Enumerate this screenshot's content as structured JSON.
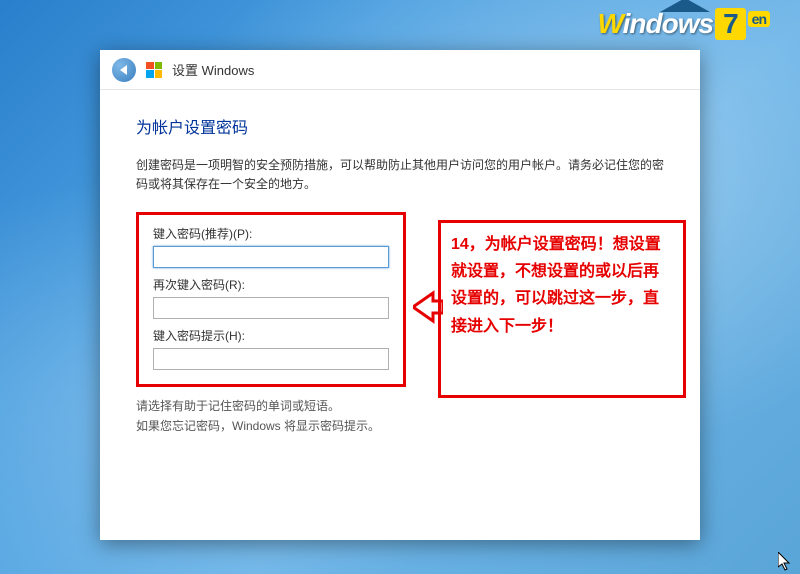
{
  "logo": {
    "brand_w": "W",
    "brand_indows": "indows",
    "brand_7": "7",
    "brand_suffix": "en"
  },
  "titlebar": {
    "title": "设置 Windows"
  },
  "content": {
    "heading": "为帐户设置密码",
    "description": "创建密码是一项明智的安全预防措施，可以帮助防止其他用户访问您的用户帐户。请务必记住您的密码或将其保存在一个安全的地方。",
    "labels": {
      "password": "键入密码(推荐)(P):",
      "confirm": "再次键入密码(R):",
      "hint": "键入密码提示(H):"
    },
    "below": {
      "line1": "请选择有助于记住密码的单词或短语。",
      "line2": "如果您忘记密码，Windows 将显示密码提示。"
    }
  },
  "callout": {
    "text": "14，为帐户设置密码！想设置就设置，不想设置的或以后再设置的，可以跳过这一步，直接进入下一步！"
  },
  "colors": {
    "accent_red": "#e60000",
    "heading_blue": "#003399"
  }
}
